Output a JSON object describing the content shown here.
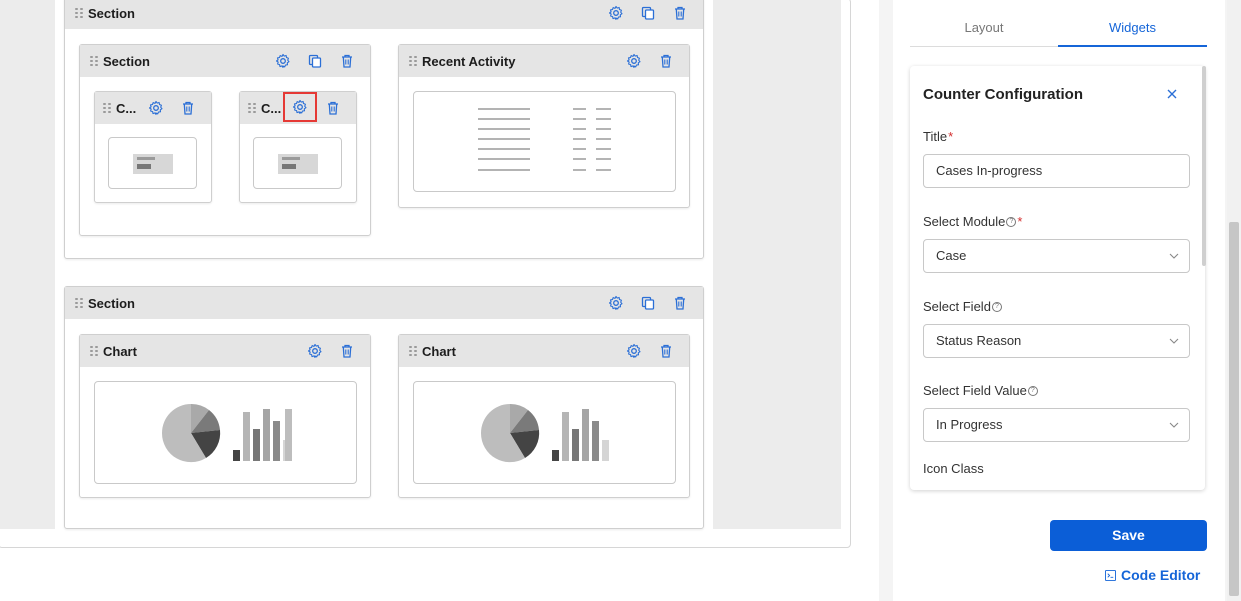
{
  "canvas": {
    "top_section": {
      "title": "Section"
    },
    "inner_section": {
      "title": "Section"
    },
    "counter_widget_1": {
      "title": "C..."
    },
    "counter_widget_2": {
      "title": "C..."
    },
    "recent_activity": {
      "title": "Recent Activity"
    },
    "bottom_section": {
      "title": "Section"
    },
    "chart_widget_1": {
      "title": "Chart"
    },
    "chart_widget_2": {
      "title": "Chart"
    }
  },
  "panel": {
    "tabs": [
      {
        "label": "Layout",
        "active": false
      },
      {
        "label": "Widgets",
        "active": true
      }
    ],
    "card": {
      "title": "Counter Configuration",
      "title_label": "Title",
      "title_value": "Cases In-progress",
      "module_label": "Select Module",
      "module_value": "Case",
      "field_label": "Select Field",
      "field_value": "Status Reason",
      "field_value_label": "Select Field Value",
      "field_value_value": "In Progress",
      "icon_class_label": "Icon Class"
    },
    "save_label": "Save",
    "code_editor_label": "Code Editor"
  },
  "colors": {
    "accent": "#1565d8",
    "primary_button": "#0b5ed7",
    "required": "#d32f2f",
    "highlight": "#e53935",
    "header_bg": "#e5e5e5"
  }
}
